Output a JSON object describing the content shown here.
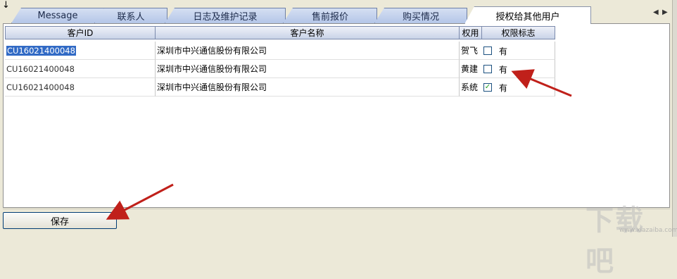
{
  "tabs": [
    {
      "label": "Message",
      "active": false
    },
    {
      "label": "联系人",
      "active": false
    },
    {
      "label": "日志及维护记录",
      "active": false
    },
    {
      "label": "售前报价",
      "active": false
    },
    {
      "label": "购买情况",
      "active": false
    },
    {
      "label": "授权给其他用户",
      "active": true
    }
  ],
  "tab_scroll": {
    "left": "◀",
    "right": "▶"
  },
  "corner_arrow": "↓",
  "grid": {
    "columns": {
      "customer_id": "客户ID",
      "customer_name": "客户名称",
      "authority": "权用",
      "authority_flag": "权限标志"
    },
    "rows": [
      {
        "customer_id": "CU16021400048",
        "customer_name": "深圳市中兴通信股份有限公司",
        "user": "贺飞",
        "checked": false,
        "flag": "有",
        "selected": true
      },
      {
        "customer_id": "CU16021400048",
        "customer_name": "深圳市中兴通信股份有限公司",
        "user": "黄建",
        "checked": false,
        "flag": "有",
        "selected": false
      },
      {
        "customer_id": "CU16021400048",
        "customer_name": "深圳市中兴通信股份有限公司",
        "user": "系统",
        "checked": true,
        "flag": "有",
        "selected": false
      }
    ]
  },
  "toolbar": {
    "save_label": "保存"
  },
  "watermark": {
    "text": "下载吧",
    "url": "www.xiazaiba.com"
  },
  "colors": {
    "annotation_arrow": "#c0201a",
    "selection": "#316ac5",
    "check": "#21a121"
  }
}
